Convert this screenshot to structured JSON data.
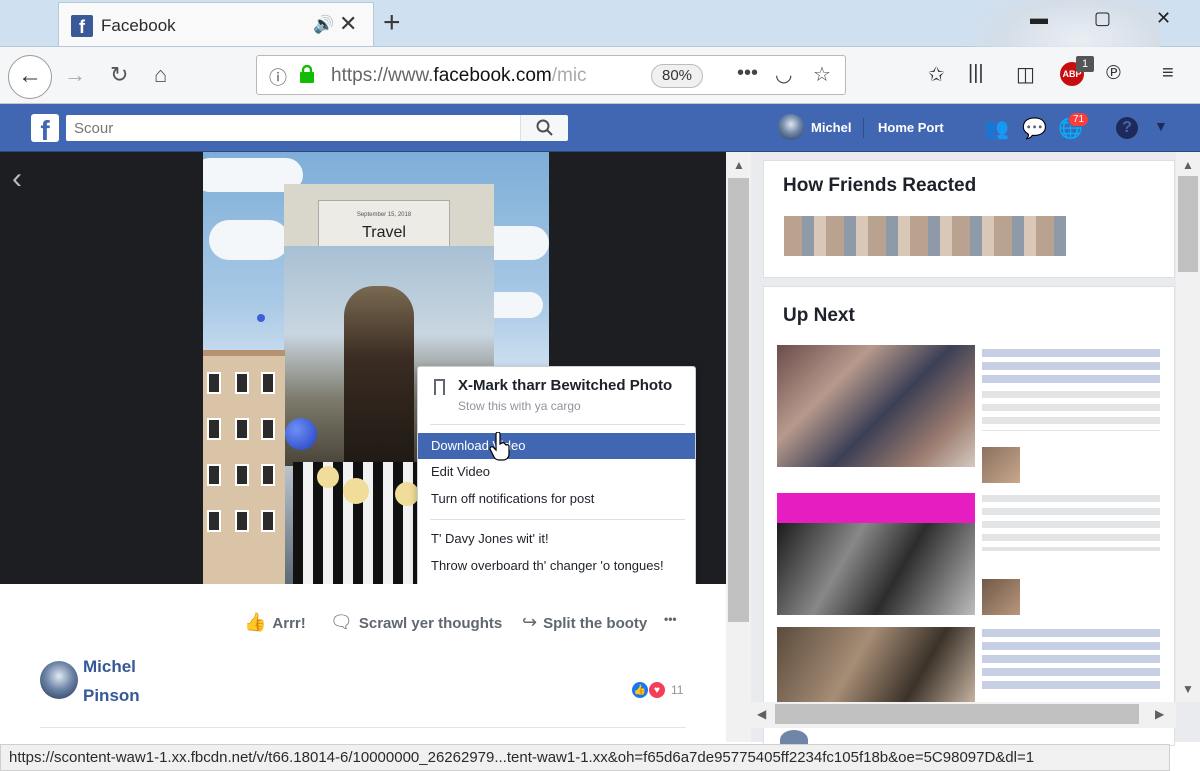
{
  "browser": {
    "tab_title": "Facebook",
    "new_tab": "+",
    "url_prefix": "https://www.",
    "url_domain": "facebook.com",
    "url_rest": "/mic",
    "zoom": "80%",
    "abp_label": "ABP",
    "abp_badge": "1",
    "status_url": "https://scontent-waw1-1.xx.fbcdn.net/v/t66.18014-6/10000000_26262979...tent-waw1-1.xx&oh=f65d6a7de95775405ff2234fc105f18b&oe=5C98097D&dl=1"
  },
  "fb": {
    "search_placeholder": "Scour",
    "user_name": "Michel",
    "home_label": "Home Port",
    "notif_count": "71"
  },
  "photo": {
    "banner_date": "September 15, 2018",
    "banner_title": "Travel"
  },
  "menu": {
    "save_title": "X-Mark tharr Bewitched Photo",
    "save_subtitle": "Stow this with ya cargo",
    "items": [
      "Download Video",
      "Edit Video",
      "Turn off notifications for post",
      "T' Davy Jones wit' it!",
      "Throw overboard th' changer 'o tongues!"
    ]
  },
  "post": {
    "like_label": "Arrr!",
    "comment_label": "Scrawl yer thoughts",
    "share_label": "Split the booty",
    "more_label": "•••",
    "author_first": "Michel",
    "author_last": "Pinson",
    "reaction_count": "11"
  },
  "sidebar": {
    "friends_title": "How Friends Reacted",
    "up_next_title": "Up Next"
  },
  "colors": {
    "fb_blue": "#4267b2",
    "menu_highlight": "#4267b2",
    "link_blue": "#365899"
  }
}
